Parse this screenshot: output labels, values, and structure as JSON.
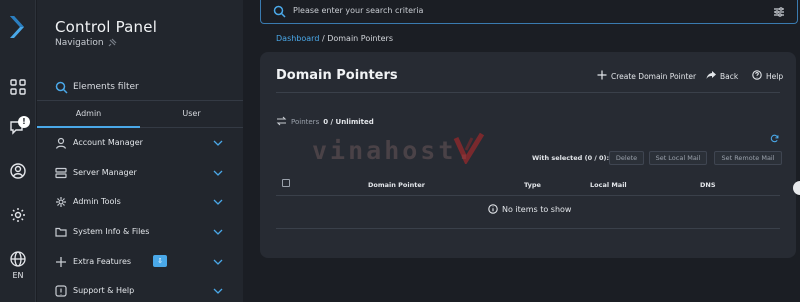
{
  "app": {
    "title": "Control Panel",
    "subtitle": "Navigation",
    "language": "EN",
    "notification_badge": "!"
  },
  "sidebar": {
    "filter_label": "Elements filter",
    "tabs": [
      {
        "label": "Admin",
        "active": true
      },
      {
        "label": "User",
        "active": false
      }
    ],
    "items": [
      {
        "label": "Account Manager",
        "icon": "user-icon"
      },
      {
        "label": "Server Manager",
        "icon": "server-icon"
      },
      {
        "label": "Admin Tools",
        "icon": "tools-icon"
      },
      {
        "label": "System Info & Files",
        "icon": "folder-icon"
      },
      {
        "label": "Extra Features",
        "icon": "plus-icon",
        "badge": "⇩"
      },
      {
        "label": "Support & Help",
        "icon": "help-icon"
      }
    ]
  },
  "search": {
    "placeholder": "Please enter your search criteria"
  },
  "breadcrumb": {
    "root": "Dashboard",
    "separator": " / ",
    "current": "Domain Pointers"
  },
  "page": {
    "title": "Domain Pointers",
    "actions": {
      "create": "Create Domain Pointer",
      "back": "Back",
      "help": "Help"
    },
    "pointers_label": "Pointers",
    "pointers_value": "0 / Unlimited",
    "with_selected": "With selected (0 / 0):",
    "buttons": {
      "delete": "Delete",
      "set_local_mail": "Set Local Mail",
      "set_remote_mail": "Set Remote Mail"
    },
    "columns": [
      "Domain Pointer",
      "Type",
      "Local Mail",
      "DNS"
    ],
    "empty_message": "No items to show"
  },
  "watermark": "vinahost.",
  "colors": {
    "accent": "#4aa8e8",
    "background": "#1b1e24",
    "sidebar": "#22262d",
    "card": "#272b33"
  }
}
